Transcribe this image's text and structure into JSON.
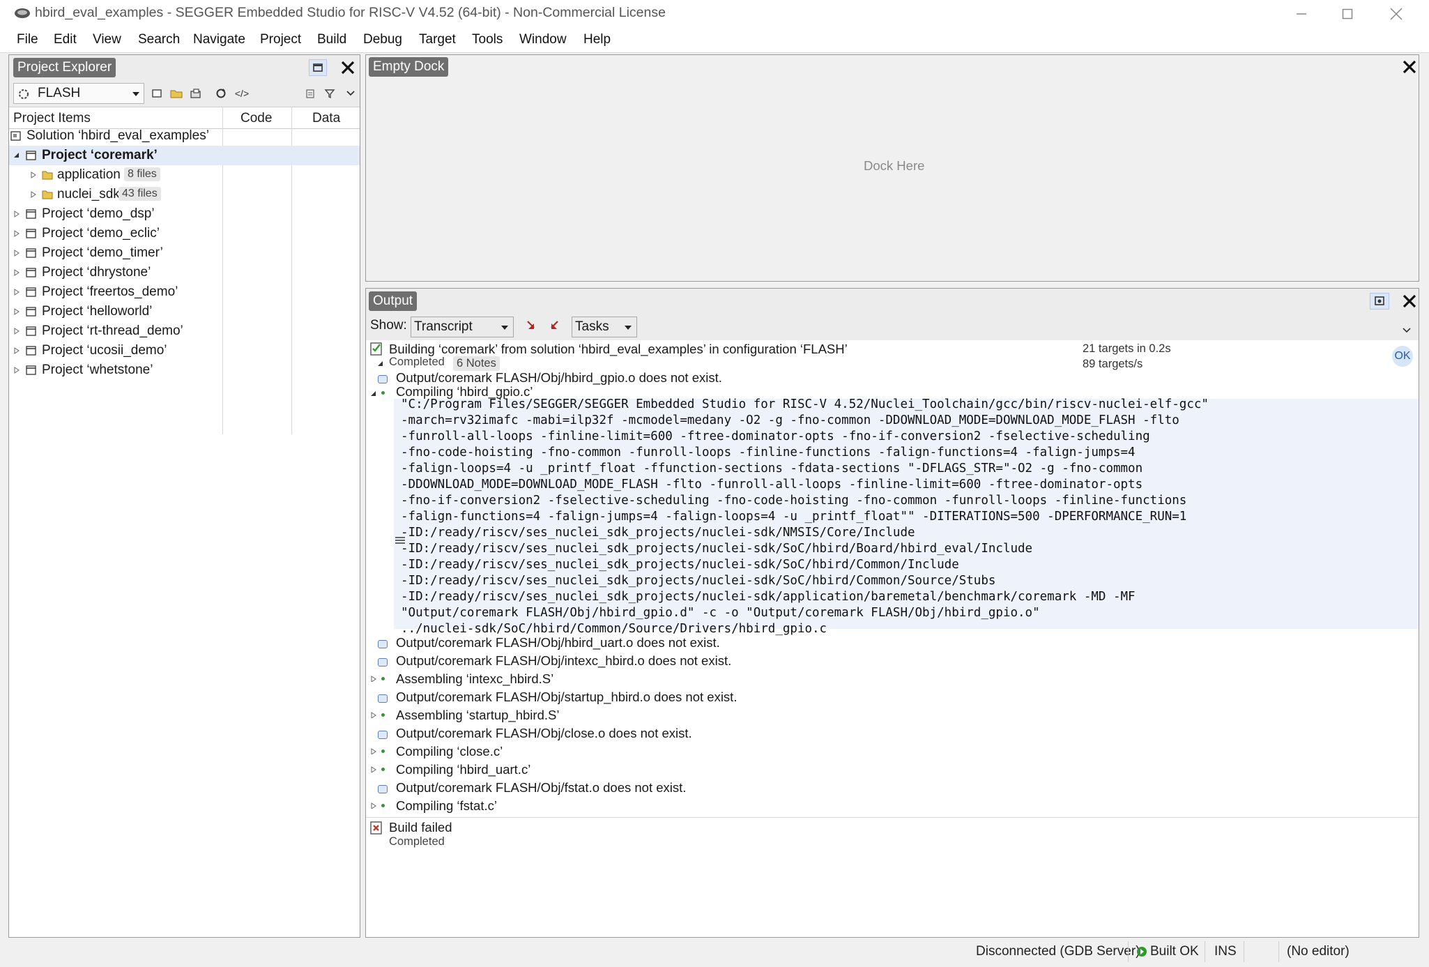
{
  "window": {
    "title": "hbird_eval_examples - SEGGER Embedded Studio for RISC-V V4.52 (64-bit) - Non-Commercial License"
  },
  "menu": [
    "File",
    "Edit",
    "View",
    "Search",
    "Navigate",
    "Project",
    "Build",
    "Debug",
    "Target",
    "Tools",
    "Window",
    "Help"
  ],
  "explorer": {
    "title": "Project Explorer",
    "configuration": "FLASH",
    "columns": [
      "Project Items",
      "Code",
      "Data"
    ],
    "solution": "Solution ‘hbird_eval_examples’",
    "active_project": "Project ‘coremark’",
    "folders": [
      {
        "name": "application",
        "count": "8 files"
      },
      {
        "name": "nuclei_sdk",
        "count": "43 files"
      }
    ],
    "projects": [
      "Project ‘demo_dsp’",
      "Project ‘demo_eclic’",
      "Project ‘demo_timer’",
      "Project ‘dhrystone’",
      "Project ‘freertos_demo’",
      "Project ‘helloworld’",
      "Project ‘rt-thread_demo’",
      "Project ‘ucosii_demo’",
      "Project ‘whetstone’"
    ],
    "icons": [
      "build-configuration-icon",
      "new-file-icon",
      "open-folder-icon",
      "add-existing-icon",
      "refresh-icon",
      "code-view-icon",
      "properties-icon",
      "filter-icon",
      "chevron-down-icon"
    ]
  },
  "dock": {
    "title": "Empty Dock",
    "placeholder": "Dock Here"
  },
  "output": {
    "title": "Output",
    "show_label": "Show:",
    "show_value": "Transcript",
    "tasks_value": "Tasks",
    "build": {
      "heading": "Building ‘coremark’ from solution ‘hbird_eval_examples’ in configuration ‘FLASH’",
      "status": "Completed",
      "notes": "6 Notes",
      "targets": "21 targets in 0.2s",
      "rate": "89 targets/s",
      "ok": "OK"
    },
    "entries": [
      {
        "kind": "note",
        "text": "Output/coremark FLASH/Obj/hbird_gpio.o does not exist."
      },
      {
        "kind": "step",
        "text": "Compiling ‘hbird_gpio.c’",
        "expanded": true
      }
    ],
    "command_lines": [
      "\"C:/Program Files/SEGGER/SEGGER Embedded Studio for RISC-V 4.52/Nuclei_Toolchain/gcc/bin/riscv-nuclei-elf-gcc\"",
      "-march=rv32imafc -mabi=ilp32f -mcmodel=medany -O2 -g -fno-common -DDOWNLOAD_MODE=DOWNLOAD_MODE_FLASH -flto",
      "-funroll-all-loops -finline-limit=600 -ftree-dominator-opts -fno-if-conversion2 -fselective-scheduling",
      "-fno-code-hoisting -fno-common -funroll-loops -finline-functions -falign-functions=4 -falign-jumps=4",
      "-falign-loops=4 -u _printf_float -ffunction-sections -fdata-sections \"-DFLAGS_STR=\"-O2 -g -fno-common",
      "-DDOWNLOAD_MODE=DOWNLOAD_MODE_FLASH -flto -funroll-all-loops -finline-limit=600 -ftree-dominator-opts",
      "-fno-if-conversion2 -fselective-scheduling -fno-code-hoisting -fno-common -funroll-loops -finline-functions",
      "-falign-functions=4 -falign-jumps=4 -falign-loops=4 -u _printf_float\"\" -DITERATIONS=500 -DPERFORMANCE_RUN=1",
      "-ID:/ready/riscv/ses_nuclei_sdk_projects/nuclei-sdk/NMSIS/Core/Include",
      "-ID:/ready/riscv/ses_nuclei_sdk_projects/nuclei-sdk/SoC/hbird/Board/hbird_eval/Include",
      "-ID:/ready/riscv/ses_nuclei_sdk_projects/nuclei-sdk/SoC/hbird/Common/Include",
      "-ID:/ready/riscv/ses_nuclei_sdk_projects/nuclei-sdk/SoC/hbird/Common/Source/Stubs",
      "-ID:/ready/riscv/ses_nuclei_sdk_projects/nuclei-sdk/application/baremetal/benchmark/coremark -MD -MF",
      "\"Output/coremark FLASH/Obj/hbird_gpio.d\" -c -o \"Output/coremark FLASH/Obj/hbird_gpio.o\"",
      "../nuclei-sdk/SoC/hbird/Common/Source/Drivers/hbird_gpio.c"
    ],
    "after_entries": [
      {
        "kind": "note",
        "text": "Output/coremark FLASH/Obj/hbird_uart.o does not exist."
      },
      {
        "kind": "note",
        "text": "Output/coremark FLASH/Obj/intexc_hbird.o does not exist."
      },
      {
        "kind": "step",
        "text": "Assembling ‘intexc_hbird.S’"
      },
      {
        "kind": "note",
        "text": "Output/coremark FLASH/Obj/startup_hbird.o does not exist."
      },
      {
        "kind": "step",
        "text": "Assembling ‘startup_hbird.S’"
      },
      {
        "kind": "note",
        "text": "Output/coremark FLASH/Obj/close.o does not exist."
      },
      {
        "kind": "step",
        "text": "Compiling ‘close.c’"
      },
      {
        "kind": "step",
        "text": "Compiling ‘hbird_uart.c’"
      },
      {
        "kind": "note",
        "text": "Output/coremark FLASH/Obj/fstat.o does not exist."
      },
      {
        "kind": "step",
        "text": "Compiling ‘fstat.c’"
      }
    ],
    "failure": {
      "heading": "Build failed",
      "status": "Completed"
    }
  },
  "status_bar": {
    "connection": "Disconnected (GDB Server)",
    "build": "Built OK",
    "insert": "INS",
    "editor": "(No editor)"
  },
  "colors": {
    "accent_selection": "#e3ebf8",
    "pane_title": "#6f6f6f",
    "ok_green": "#2e9a2e",
    "error_red": "#c0392b"
  }
}
